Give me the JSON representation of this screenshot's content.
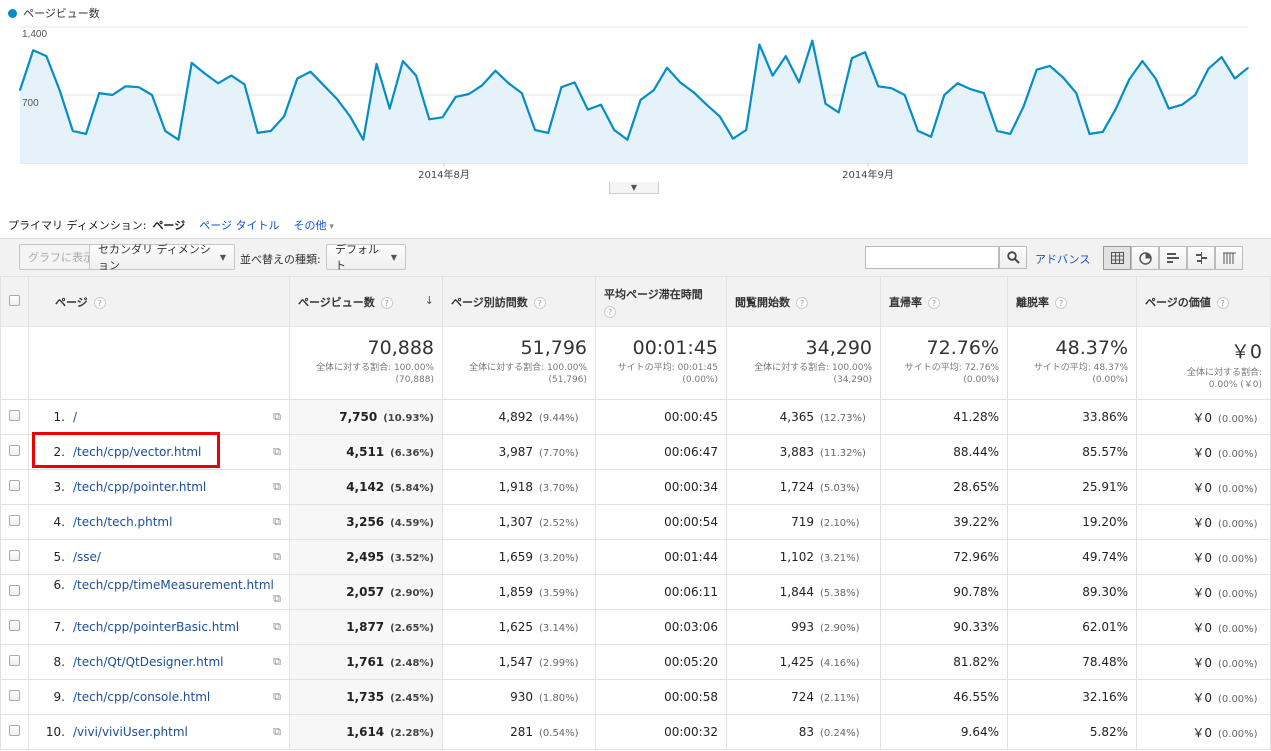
{
  "chart": {
    "legend": "ページビュー数",
    "y_ticks": [
      "1,400",
      "700"
    ],
    "x_labels": [
      "2014年8月",
      "2014年9月"
    ],
    "line_color": "#058dc7"
  },
  "chart_data": {
    "type": "area",
    "title": "",
    "series": [
      {
        "name": "ページビュー数",
        "values": [
          750,
          1160,
          1100,
          750,
          330,
          300,
          720,
          700,
          790,
          780,
          700,
          330,
          240,
          1030,
          920,
          820,
          900,
          810,
          310,
          330,
          480,
          870,
          940,
          800,
          660,
          480,
          240,
          1020,
          560,
          1050,
          900,
          450,
          470,
          680,
          710,
          800,
          950,
          820,
          720,
          340,
          310,
          780,
          830,
          550,
          600,
          340,
          240,
          650,
          750,
          980,
          830,
          730,
          600,
          480,
          250,
          340,
          1220,
          900,
          1100,
          830,
          1260,
          610,
          520,
          1080,
          1140,
          790,
          770,
          700,
          330,
          270,
          700,
          820,
          760,
          720,
          330,
          300,
          580,
          960,
          1000,
          880,
          720,
          300,
          320,
          560,
          860,
          1050,
          870,
          560,
          600,
          700,
          970,
          1090,
          870,
          980
        ]
      }
    ],
    "ylim": [
      0,
      1500
    ],
    "x_labels": [
      "2014年8月",
      "2014年9月"
    ]
  },
  "dimension_bar": {
    "label": "プライマリ ディメンション:",
    "active": "ページ",
    "page_title": "ページ タイトル",
    "other": "その他"
  },
  "toolbar": {
    "plot_rows": "グラフに表示",
    "secondary_dimension": "セカンダリ ディメンション",
    "sort_label": "並べ替えの種類:",
    "sort_value": "デフォルト",
    "search_placeholder": "",
    "advanced": "アドバンス"
  },
  "columns": {
    "page": "ページ",
    "pageviews": "ページビュー数",
    "unique": "ページ別訪問数",
    "avg_time": "平均ページ滞在時間",
    "entrances": "閲覧開始数",
    "bounce": "直帰率",
    "exit": "離脱率",
    "value": "ページの価値"
  },
  "summary": {
    "pageviews": {
      "total": "70,888",
      "line1": "全体に対する割合: 100.00%",
      "line2": "(70,888)"
    },
    "unique": {
      "total": "51,796",
      "line1": "全体に対する割合: 100.00%",
      "line2": "(51,796)"
    },
    "avg_time": {
      "total": "00:01:45",
      "line1": "サイトの平均: 00:01:45",
      "line2": "(0.00%)"
    },
    "entrances": {
      "total": "34,290",
      "line1": "全体に対する割合: 100.00%",
      "line2": "(34,290)"
    },
    "bounce": {
      "total": "72.76%",
      "line1": "サイトの平均: 72.76%",
      "line2": "(0.00%)"
    },
    "exit": {
      "total": "48.37%",
      "line1": "サイトの平均: 48.37%",
      "line2": "(0.00%)"
    },
    "value": {
      "total": "￥0",
      "line1": "全体に対する割合:",
      "line2": "0.00% (￥0)"
    }
  },
  "rows": [
    {
      "rank": "1.",
      "page": "/",
      "pv": "7,750",
      "pv_pct": "(10.93%)",
      "unique": "4,892",
      "unique_pct": "(9.44%)",
      "time": "00:00:45",
      "ent": "4,365",
      "ent_pct": "(12.73%)",
      "bounce": "41.28%",
      "exit": "33.86%",
      "value": "￥0",
      "value_pct": "(0.00%)"
    },
    {
      "rank": "2.",
      "page": "/tech/cpp/vector.html",
      "pv": "4,511",
      "pv_pct": "(6.36%)",
      "unique": "3,987",
      "unique_pct": "(7.70%)",
      "time": "00:06:47",
      "ent": "3,883",
      "ent_pct": "(11.32%)",
      "bounce": "88.44%",
      "exit": "85.57%",
      "value": "￥0",
      "value_pct": "(0.00%)"
    },
    {
      "rank": "3.",
      "page": "/tech/cpp/pointer.html",
      "pv": "4,142",
      "pv_pct": "(5.84%)",
      "unique": "1,918",
      "unique_pct": "(3.70%)",
      "time": "00:00:34",
      "ent": "1,724",
      "ent_pct": "(5.03%)",
      "bounce": "28.65%",
      "exit": "25.91%",
      "value": "￥0",
      "value_pct": "(0.00%)"
    },
    {
      "rank": "4.",
      "page": "/tech/tech.phtml",
      "pv": "3,256",
      "pv_pct": "(4.59%)",
      "unique": "1,307",
      "unique_pct": "(2.52%)",
      "time": "00:00:54",
      "ent": "719",
      "ent_pct": "(2.10%)",
      "bounce": "39.22%",
      "exit": "19.20%",
      "value": "￥0",
      "value_pct": "(0.00%)"
    },
    {
      "rank": "5.",
      "page": "/sse/",
      "pv": "2,495",
      "pv_pct": "(3.52%)",
      "unique": "1,659",
      "unique_pct": "(3.20%)",
      "time": "00:01:44",
      "ent": "1,102",
      "ent_pct": "(3.21%)",
      "bounce": "72.96%",
      "exit": "49.74%",
      "value": "￥0",
      "value_pct": "(0.00%)"
    },
    {
      "rank": "6.",
      "page": "/tech/cpp/timeMeasurement.html",
      "pv": "2,057",
      "pv_pct": "(2.90%)",
      "unique": "1,859",
      "unique_pct": "(3.59%)",
      "time": "00:06:11",
      "ent": "1,844",
      "ent_pct": "(5.38%)",
      "bounce": "90.78%",
      "exit": "89.30%",
      "value": "￥0",
      "value_pct": "(0.00%)"
    },
    {
      "rank": "7.",
      "page": "/tech/cpp/pointerBasic.html",
      "pv": "1,877",
      "pv_pct": "(2.65%)",
      "unique": "1,625",
      "unique_pct": "(3.14%)",
      "time": "00:03:06",
      "ent": "993",
      "ent_pct": "(2.90%)",
      "bounce": "90.33%",
      "exit": "62.01%",
      "value": "￥0",
      "value_pct": "(0.00%)"
    },
    {
      "rank": "8.",
      "page": "/tech/Qt/QtDesigner.html",
      "pv": "1,761",
      "pv_pct": "(2.48%)",
      "unique": "1,547",
      "unique_pct": "(2.99%)",
      "time": "00:05:20",
      "ent": "1,425",
      "ent_pct": "(4.16%)",
      "bounce": "81.82%",
      "exit": "78.48%",
      "value": "￥0",
      "value_pct": "(0.00%)"
    },
    {
      "rank": "9.",
      "page": "/tech/cpp/console.html",
      "pv": "1,735",
      "pv_pct": "(2.45%)",
      "unique": "930",
      "unique_pct": "(1.80%)",
      "time": "00:00:58",
      "ent": "724",
      "ent_pct": "(2.11%)",
      "bounce": "46.55%",
      "exit": "32.16%",
      "value": "￥0",
      "value_pct": "(0.00%)"
    },
    {
      "rank": "10.",
      "page": "/vivi/viviUser.phtml",
      "pv": "1,614",
      "pv_pct": "(2.28%)",
      "unique": "281",
      "unique_pct": "(0.54%)",
      "time": "00:00:32",
      "ent": "83",
      "ent_pct": "(0.24%)",
      "bounce": "9.64%",
      "exit": "5.82%",
      "value": "￥0",
      "value_pct": "(0.00%)"
    }
  ]
}
